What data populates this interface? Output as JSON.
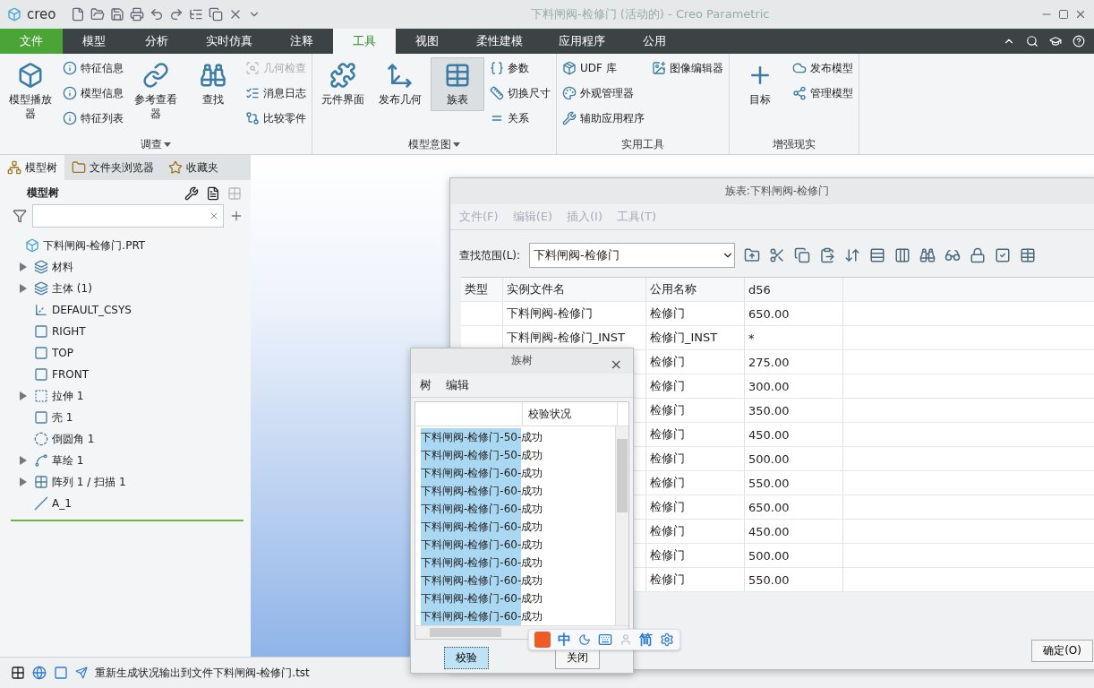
{
  "window": {
    "app_name": "creo",
    "title": "下料闸阀-检修门 (活动的) - Creo Parametric"
  },
  "ribbon_tabs": [
    {
      "label": "文件",
      "kind": "file",
      "selected": false
    },
    {
      "label": "模型",
      "kind": "tab",
      "selected": false
    },
    {
      "label": "分析",
      "kind": "tab",
      "selected": false
    },
    {
      "label": "实时仿真",
      "kind": "tab",
      "selected": false
    },
    {
      "label": "注释",
      "kind": "tab",
      "selected": false
    },
    {
      "label": "工具",
      "kind": "tab",
      "selected": true
    },
    {
      "label": "视图",
      "kind": "tab",
      "selected": false
    },
    {
      "label": "柔性建模",
      "kind": "tab",
      "selected": false
    },
    {
      "label": "应用程序",
      "kind": "tab",
      "selected": false
    },
    {
      "label": "公用",
      "kind": "tab",
      "selected": false
    }
  ],
  "ribbon_groups": [
    {
      "label": "调查",
      "has_menu": true,
      "columns": [
        [
          {
            "label": "模型播放器",
            "kind": "large",
            "disabled": false,
            "selected": false
          }
        ],
        [
          {
            "label": "特征信息",
            "kind": "small",
            "disabled": false,
            "selected": false
          },
          {
            "label": "模型信息",
            "kind": "small",
            "disabled": false,
            "selected": false
          },
          {
            "label": "特征列表",
            "kind": "small",
            "disabled": false,
            "selected": false
          }
        ],
        [
          {
            "label": "参考查看器",
            "kind": "large",
            "disabled": false,
            "selected": false
          }
        ],
        [
          {
            "label": "查找",
            "kind": "large",
            "disabled": false,
            "selected": false
          }
        ],
        [
          {
            "label": "几何检查",
            "kind": "small",
            "disabled": true,
            "selected": false
          },
          {
            "label": "消息日志",
            "kind": "small",
            "disabled": false,
            "selected": false
          },
          {
            "label": "比较零件",
            "kind": "small",
            "disabled": false,
            "selected": false
          }
        ]
      ]
    },
    {
      "label": "模型意图",
      "has_menu": true,
      "columns": [
        [
          {
            "label": "元件界面",
            "kind": "large",
            "disabled": false,
            "selected": false
          }
        ],
        [
          {
            "label": "发布几何",
            "kind": "large",
            "disabled": false,
            "selected": false
          }
        ],
        [
          {
            "label": "族表",
            "kind": "large",
            "disabled": false,
            "selected": true
          }
        ],
        [
          {
            "label": "参数",
            "kind": "small",
            "disabled": false,
            "selected": false
          },
          {
            "label": "切换尺寸",
            "kind": "small",
            "disabled": false,
            "selected": false
          },
          {
            "label": "关系",
            "kind": "small",
            "disabled": false,
            "selected": false
          }
        ]
      ]
    },
    {
      "label": "实用工具",
      "has_menu": false,
      "columns": [
        [
          {
            "label": "UDF 库",
            "kind": "small",
            "disabled": false,
            "selected": false
          },
          {
            "label": "外观管理器",
            "kind": "small",
            "disabled": false,
            "selected": false
          },
          {
            "label": "辅助应用程序",
            "kind": "small",
            "disabled": false,
            "selected": false
          }
        ],
        [
          {
            "label": "图像编辑器",
            "kind": "small",
            "disabled": false,
            "selected": false
          }
        ]
      ]
    },
    {
      "label": "增强现实",
      "has_menu": false,
      "columns": [
        [
          {
            "label": "目标",
            "kind": "large",
            "disabled": false,
            "selected": false
          }
        ],
        [
          {
            "label": "发布模型",
            "kind": "small",
            "disabled": false,
            "selected": false
          },
          {
            "label": "管理模型",
            "kind": "small",
            "disabled": false,
            "selected": false
          }
        ]
      ]
    }
  ],
  "side_panel": {
    "tabs": [
      {
        "label": "模型树",
        "selected": true
      },
      {
        "label": "文件夹浏览器",
        "selected": false
      },
      {
        "label": "收藏夹",
        "selected": false
      }
    ],
    "title": "模型树",
    "tree": [
      {
        "label": "下料闸阀-检修门.PRT",
        "has_children": false,
        "children": [
          {
            "label": "材料",
            "has_children": true
          },
          {
            "label": "主体 (1)",
            "has_children": true
          },
          {
            "label": "DEFAULT_CSYS",
            "has_children": false
          },
          {
            "label": "RIGHT",
            "has_children": false
          },
          {
            "label": "TOP",
            "has_children": false
          },
          {
            "label": "FRONT",
            "has_children": false
          },
          {
            "label": "拉伸 1",
            "has_children": true
          },
          {
            "label": "壳 1",
            "has_children": false
          },
          {
            "label": "倒圆角 1",
            "has_children": false
          },
          {
            "label": "草绘 1",
            "has_children": true
          },
          {
            "label": "阵列 1 / 扫描 1",
            "has_children": true
          },
          {
            "label": "A_1",
            "has_children": false
          }
        ]
      }
    ]
  },
  "family_table": {
    "title": "族表:下料闸阀-检修门",
    "menu": [
      "文件(F)",
      "编辑(E)",
      "插入(I)",
      "工具(T)"
    ],
    "scope_label": "查找范围(L):",
    "scope_value": "下料闸阀-检修门",
    "columns": [
      "类型",
      "实例文件名",
      "公用名称",
      "d56"
    ],
    "rows": [
      {
        "instance_name": "下料闸阀-检修门",
        "common_name": "检修门",
        "d56": "650.00"
      },
      {
        "instance_name": "下料闸阀-检修门_INST",
        "common_name": "检修门_INST",
        "d56": "*"
      },
      {
        "common_name": "检修门",
        "d56": "275.00"
      },
      {
        "common_name": "检修门",
        "d56": "300.00"
      },
      {
        "common_name": "检修门",
        "d56": "350.00"
      },
      {
        "common_name": "检修门",
        "d56": "450.00"
      },
      {
        "common_name": "检修门",
        "d56": "500.00"
      },
      {
        "common_name": "检修门",
        "d56": "550.00"
      },
      {
        "common_name": "检修门",
        "d56": "650.00"
      },
      {
        "common_name": "检修门",
        "d56": "450.00"
      },
      {
        "common_name": "检修门",
        "d56": "500.00"
      },
      {
        "common_name": "检修门",
        "d56": "550.00"
      }
    ],
    "ok_button": "确定(O)"
  },
  "family_tree": {
    "title": "族树",
    "close": "×",
    "menu": [
      "树",
      "编辑"
    ],
    "status_header": "校验状况",
    "rows": [
      {
        "name": "下料闸阀-检修门-50-",
        "status": "成功",
        "selected": true
      },
      {
        "name": "下料闸阀-检修门-50-",
        "status": "成功",
        "selected": true
      },
      {
        "name": "下料闸阀-检修门-60-",
        "status": "成功",
        "selected": true
      },
      {
        "name": "下料闸阀-检修门-60-",
        "status": "成功",
        "selected": true
      },
      {
        "name": "下料闸阀-检修门-60-",
        "status": "成功",
        "selected": true
      },
      {
        "name": "下料闸阀-检修门-60-",
        "status": "成功",
        "selected": true
      },
      {
        "name": "下料闸阀-检修门-60-",
        "status": "成功",
        "selected": true
      },
      {
        "name": "下料闸阀-检修门-60-",
        "status": "成功",
        "selected": true
      },
      {
        "name": "下料闸阀-检修门-60-",
        "status": "成功",
        "selected": true
      },
      {
        "name": "下料闸阀-检修门-60-",
        "status": "成功",
        "selected": true
      },
      {
        "name": "下料闸阀-检修门-60-",
        "status": "成功",
        "selected": true
      }
    ],
    "buttons": [
      {
        "label": "校验",
        "selected": true
      },
      {
        "label": "关闭",
        "selected": false
      }
    ]
  },
  "ime_bar": {
    "mode": "中",
    "script": "简"
  },
  "status_bar": {
    "message": "重新生成状况输出到文件下料闸阀-检修门.tst"
  }
}
